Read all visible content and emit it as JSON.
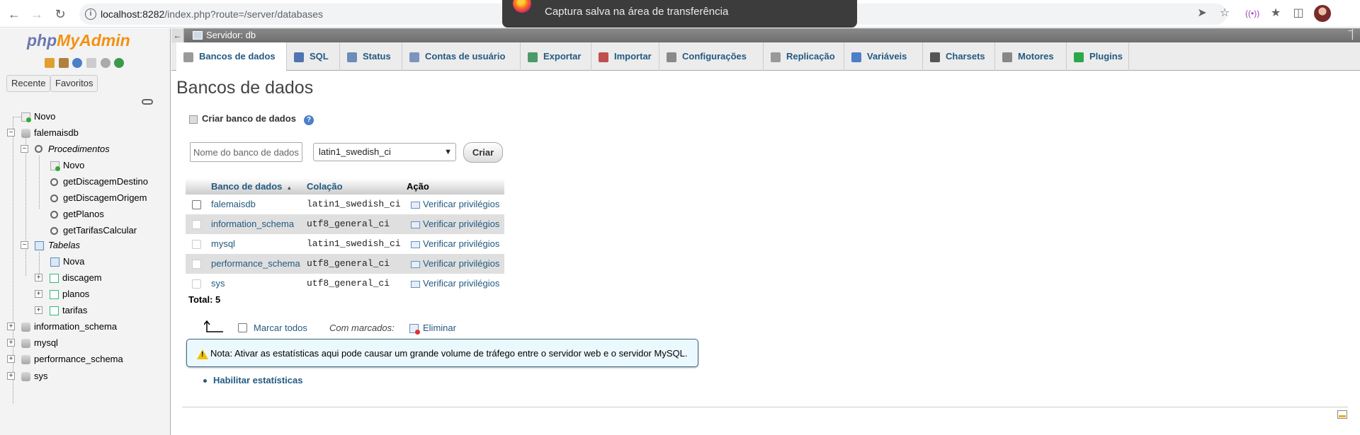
{
  "browser": {
    "url_host": "localhost:8282",
    "url_path": "/index.php?route=/server/databases"
  },
  "toast": {
    "text": "Captura salva na área de transferência"
  },
  "sidebar": {
    "logo_php": "php",
    "logo_myadmin": "MyAdmin",
    "recent_label": "Recente",
    "favorites_label": "Favoritos",
    "tree": {
      "novo": "Novo",
      "falemaisdb": "falemaisdb",
      "procedimentos": "Procedimentos",
      "proc_novo": "Novo",
      "procs": [
        "getDiscagemDestino",
        "getDiscagemOrigem",
        "getPlanos",
        "getTarifasCalcular"
      ],
      "tabelas": "Tabelas",
      "tab_nova": "Nova",
      "tables": [
        "discagem",
        "planos",
        "tarifas"
      ],
      "other_dbs": [
        "information_schema",
        "mysql",
        "performance_schema",
        "sys"
      ]
    }
  },
  "server_bar": {
    "title": "Servidor: db"
  },
  "tabs": [
    {
      "label": "Bancos de dados",
      "color": "#9a9a9a"
    },
    {
      "label": "SQL",
      "color": "#4f74b1"
    },
    {
      "label": "Status",
      "color": "#6b8db8"
    },
    {
      "label": "Contas de usuário",
      "color": "#7d95bd"
    },
    {
      "label": "Exportar",
      "color": "#4a9a6a"
    },
    {
      "label": "Importar",
      "color": "#c0504d"
    },
    {
      "label": "Configurações",
      "color": "#8a8a8a"
    },
    {
      "label": "Replicação",
      "color": "#999999"
    },
    {
      "label": "Variáveis",
      "color": "#4c7fc8"
    },
    {
      "label": "Charsets",
      "color": "#555555"
    },
    {
      "label": "Motores",
      "color": "#888888"
    },
    {
      "label": "Plugins",
      "color": "#2aa84a"
    }
  ],
  "main": {
    "title": "Bancos de dados",
    "create_label": "Criar banco de dados",
    "db_name_placeholder": "Nome do banco de dados",
    "collation_selected": "latin1_swedish_ci",
    "create_button": "Criar",
    "table": {
      "headers": {
        "name": "Banco de dados",
        "collation": "Colação",
        "action": "Ação"
      },
      "rows": [
        {
          "name": "falemaisdb",
          "collation": "latin1_swedish_ci",
          "action": "Verificar privilégios"
        },
        {
          "name": "information_schema",
          "collation": "utf8_general_ci",
          "action": "Verificar privilégios"
        },
        {
          "name": "mysql",
          "collation": "latin1_swedish_ci",
          "action": "Verificar privilégios"
        },
        {
          "name": "performance_schema",
          "collation": "utf8_general_ci",
          "action": "Verificar privilégios"
        },
        {
          "name": "sys",
          "collation": "utf8_general_ci",
          "action": "Verificar privilégios"
        }
      ]
    },
    "total": "Total: 5",
    "mark_all": "Marcar todos",
    "with_selected": "Com marcados:",
    "delete": "Eliminar",
    "notice": "Nota: Ativar as estatísticas aqui pode causar um grande volume de tráfego entre o servidor web e o servidor MySQL.",
    "enable_stats": "Habilitar estatísticas"
  }
}
